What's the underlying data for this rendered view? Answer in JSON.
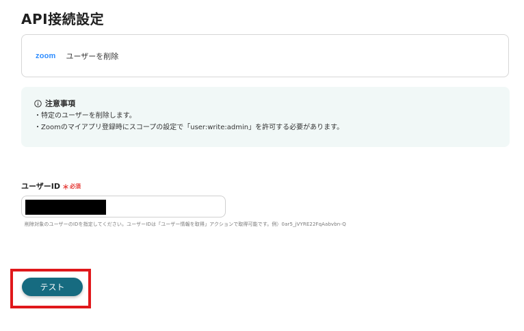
{
  "page": {
    "title": "API接続設定"
  },
  "action": {
    "app_logo": "zoom",
    "label": "ユーザーを削除"
  },
  "notice": {
    "heading": "注意事項",
    "icon": "info-circle-icon",
    "lines": [
      "・特定のユーザーを削除します。",
      "・Zoomのマイアプリ登録時にスコープの設定で「user:write:admin」を許可する必要があります。"
    ]
  },
  "user_id_field": {
    "label": "ユーザーID",
    "required_mark": "＊",
    "required_text": "必須",
    "hint": "削除対象のユーザーのIDを指定してください。ユーザーIDは「ユーザー情報を取得」アクションで取得可能です。例）0ar5_jVYRE22FqAabvbn-Q"
  },
  "test_button": {
    "label": "テスト"
  },
  "colors": {
    "button_bg": "#166b80",
    "highlight": "#e0181b",
    "notice_bg": "#f1f8f7",
    "zoom_brand": "#2d8cff",
    "required": "#e53935"
  }
}
